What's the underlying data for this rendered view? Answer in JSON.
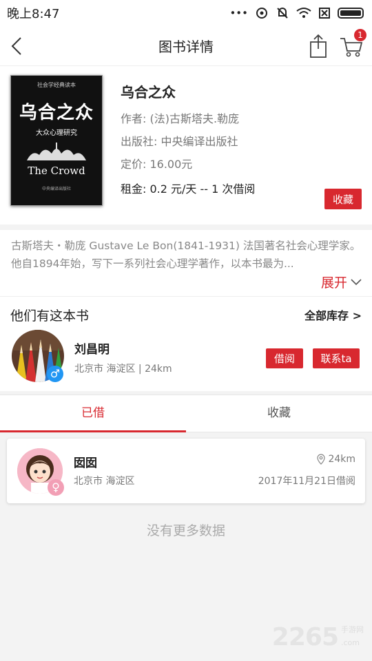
{
  "status_bar": {
    "time": "晚上8:47",
    "icons": [
      "signal-dots-icon",
      "hotspot-icon",
      "mute-icon",
      "wifi-icon",
      "no-sim-icon",
      "battery-icon"
    ]
  },
  "nav": {
    "title": "图书详情",
    "cart_count": "1"
  },
  "book": {
    "cover": {
      "series": "社会学经典读本",
      "title": "乌合之众",
      "subtitle": "大众心理研究",
      "english": "The Crowd",
      "publisher": "中央编译出版社"
    },
    "title": "乌合之众",
    "author": "作者: (法)古斯塔夫.勒庞",
    "publisher": "出版社: 中央编译出版社",
    "price": "定价: 16.00元",
    "rent": "租金: 0.2 元/天 -- 1 次借阅",
    "favorite_label": "收藏"
  },
  "description": {
    "text": "古斯塔夫・勒庞 Gustave Le Bon(1841-1931) 法国著名社会心理学家。他自1894年始，写下一系列社会心理学著作，以本书最为...",
    "expand_label": "展开"
  },
  "owners": {
    "title": "他们有这本书",
    "all_stock": "全部库存 >",
    "owner": {
      "name": "刘昌明",
      "location": "北京市 海淀区 | 24km",
      "gender": "♂",
      "borrow_label": "借阅",
      "contact_label": "联系ta"
    }
  },
  "tabs": [
    {
      "label": "已借",
      "active": true
    },
    {
      "label": "收藏",
      "active": false
    }
  ],
  "borrow_record": {
    "name": "囡囡",
    "location": "北京市 海淀区",
    "distance": "24km",
    "date": "2017年11月21日借阅",
    "gender": "♀"
  },
  "no_more": "没有更多数据",
  "watermark": {
    "number": "2265",
    "sub1": "手游网",
    "sub2": ".com"
  },
  "colors": {
    "accent": "#d8282f",
    "male": "#2196f3",
    "female": "#f29fb5"
  }
}
